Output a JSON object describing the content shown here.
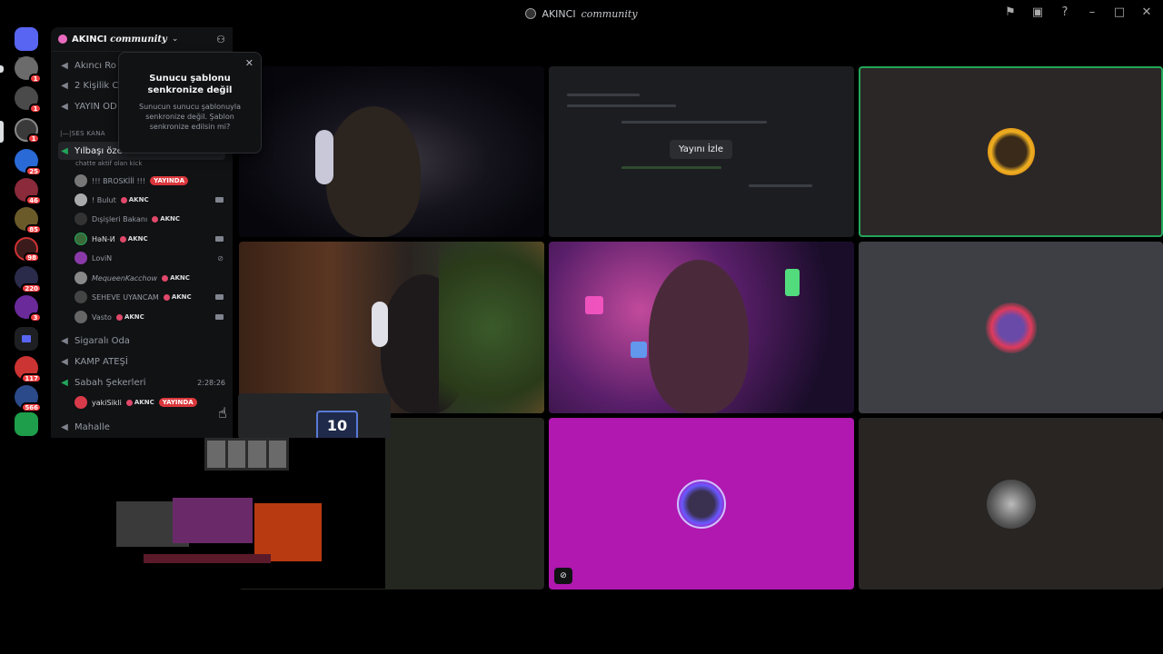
{
  "window": {
    "title_main": "AKINCI",
    "title_sub": "community"
  },
  "server_header": {
    "name_main": "AKINCI",
    "name_sub": "community"
  },
  "rail": {
    "badges": [
      "1",
      "1",
      "1",
      "25",
      "46",
      "85",
      "98",
      "220",
      "3",
      "117",
      "566"
    ]
  },
  "tooltip": {
    "title": "Sunucu şablonu senkronize değil",
    "body": "Sunucun sunucu şablonuyla senkronize değil. Şablon senkronize edilsin mi?"
  },
  "channels": {
    "top": [
      "Akıncı Ro",
      "2 Kişilik C",
      "YAYIN OD"
    ],
    "category": "|—|SES KANA",
    "active_channel": "Yılbaşı öze",
    "active_sub": "chatte aktif olan kick",
    "users": [
      {
        "name": "!!! BROSKİİİ !!!",
        "live": "YAYINDA"
      },
      {
        "name": "! Bulut",
        "tag": "AKNC"
      },
      {
        "name": "Dışişleri Bakanı",
        "tag": "AKNC"
      },
      {
        "name": "HəN-И",
        "tag": "AKNC"
      },
      {
        "name": "LoviN"
      },
      {
        "name": "MequeenKacchow",
        "tag": "AKNC"
      },
      {
        "name": "SEHEVE UYANCAM",
        "tag": "AKNC"
      },
      {
        "name": "Vasto",
        "tag": "AKNC"
      }
    ],
    "others": [
      "Sigaralı Oda",
      "KAMP ATEŞİ",
      "Sabah Şekerleri"
    ],
    "sabah_timer": "2:28:26",
    "sabah_user": {
      "name": "yakiSikli",
      "tag": "AKNC",
      "live": "YAYINDA"
    },
    "last": "Mahalle"
  },
  "stage": {
    "watch_label": "Yayını İzle",
    "ten_label": "10"
  },
  "colors": {
    "speaking_green": "#23a55a",
    "live_red": "#da373c",
    "tile_magenta": "#b018b0"
  }
}
